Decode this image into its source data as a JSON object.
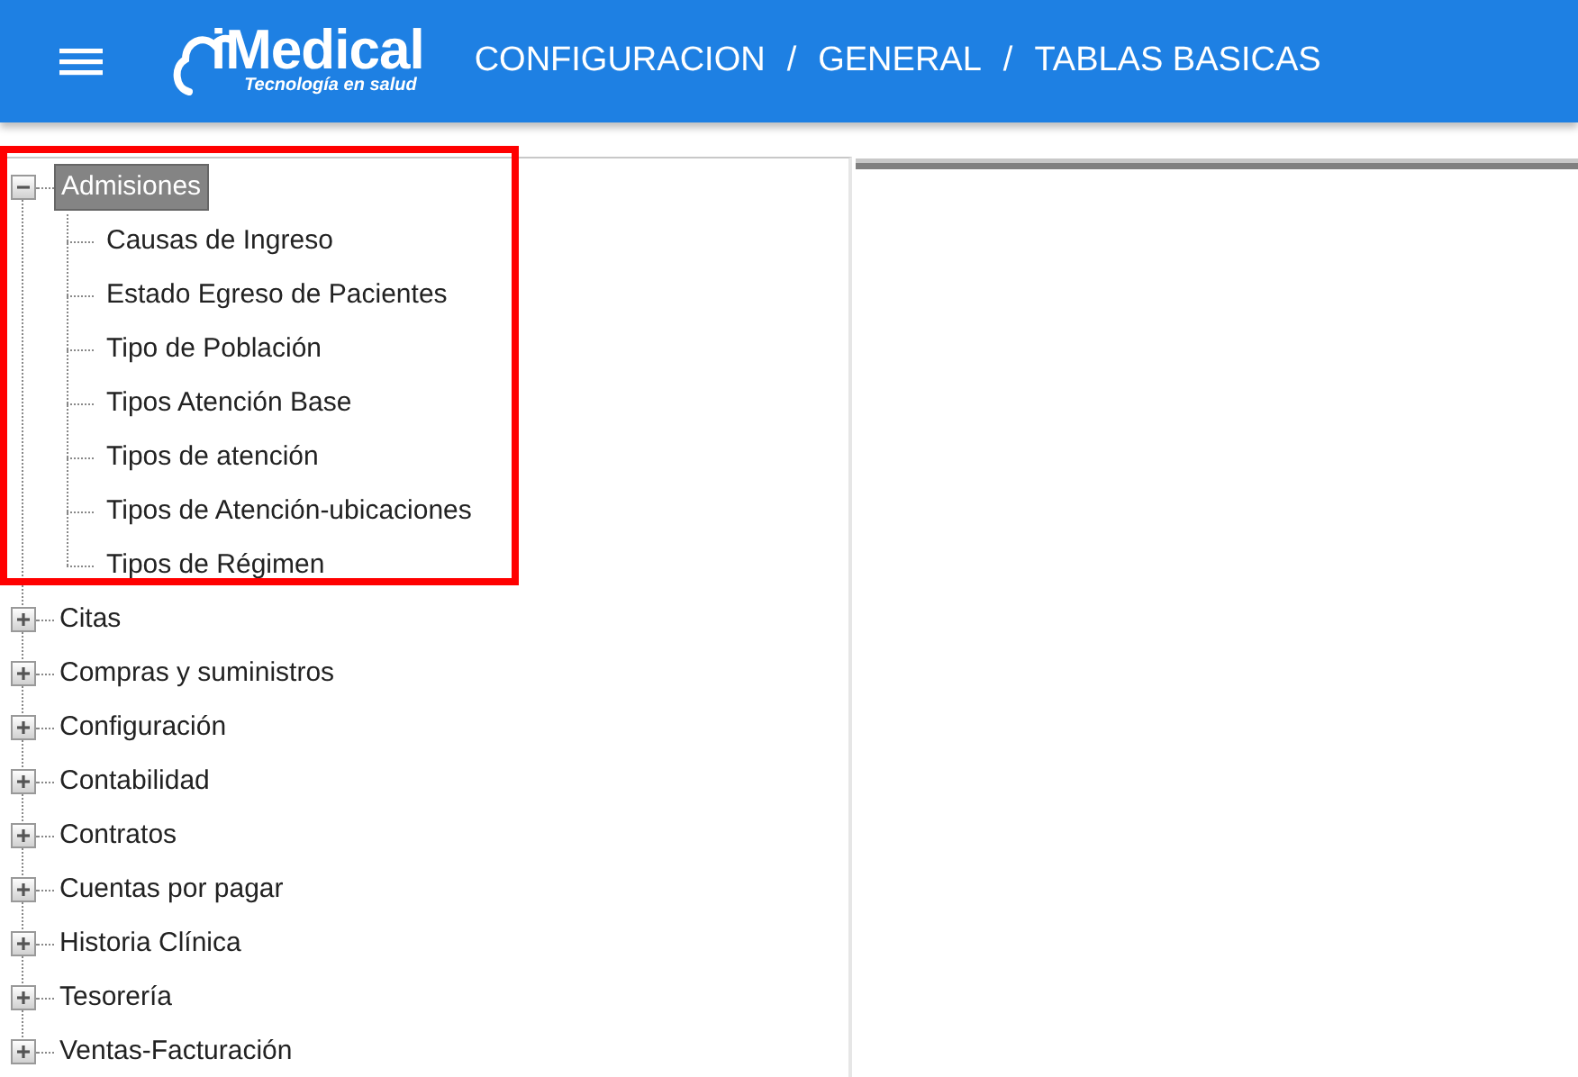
{
  "header": {
    "logo": {
      "name": "iMedical",
      "tagline": "Tecnología en salud"
    },
    "breadcrumb": [
      "CONFIGURACION",
      "GENERAL",
      "TABLAS BASICAS"
    ],
    "separator": "/"
  },
  "tree": [
    {
      "label": "Admisiones",
      "expanded": true,
      "selected": true,
      "highlighted": true,
      "children": [
        {
          "label": "Causas de Ingreso",
          "selected": false
        },
        {
          "label": "Estado Egreso de Pacientes",
          "selected": false
        },
        {
          "label": "Tipo de Población",
          "selected": false
        },
        {
          "label": "Tipos Atención Base",
          "selected": false
        },
        {
          "label": "Tipos de atención",
          "selected": false
        },
        {
          "label": "Tipos de Atención-ubicaciones",
          "selected": false
        },
        {
          "label": "Tipos de Régimen",
          "selected": false
        }
      ]
    },
    {
      "label": "Citas",
      "expanded": false,
      "selected": false,
      "highlighted": false
    },
    {
      "label": "Compras y suministros",
      "expanded": false,
      "selected": false,
      "highlighted": false
    },
    {
      "label": "Configuración",
      "expanded": false,
      "selected": false,
      "highlighted": false
    },
    {
      "label": "Contabilidad",
      "expanded": false,
      "selected": false,
      "highlighted": false
    },
    {
      "label": "Contratos",
      "expanded": false,
      "selected": false,
      "highlighted": false
    },
    {
      "label": "Cuentas por pagar",
      "expanded": false,
      "selected": false,
      "highlighted": false
    },
    {
      "label": "Historia Clínica",
      "expanded": false,
      "selected": false,
      "highlighted": false
    },
    {
      "label": "Tesorería",
      "expanded": false,
      "selected": false,
      "highlighted": false
    },
    {
      "label": "Ventas-Facturación",
      "expanded": false,
      "selected": false,
      "highlighted": false
    }
  ]
}
